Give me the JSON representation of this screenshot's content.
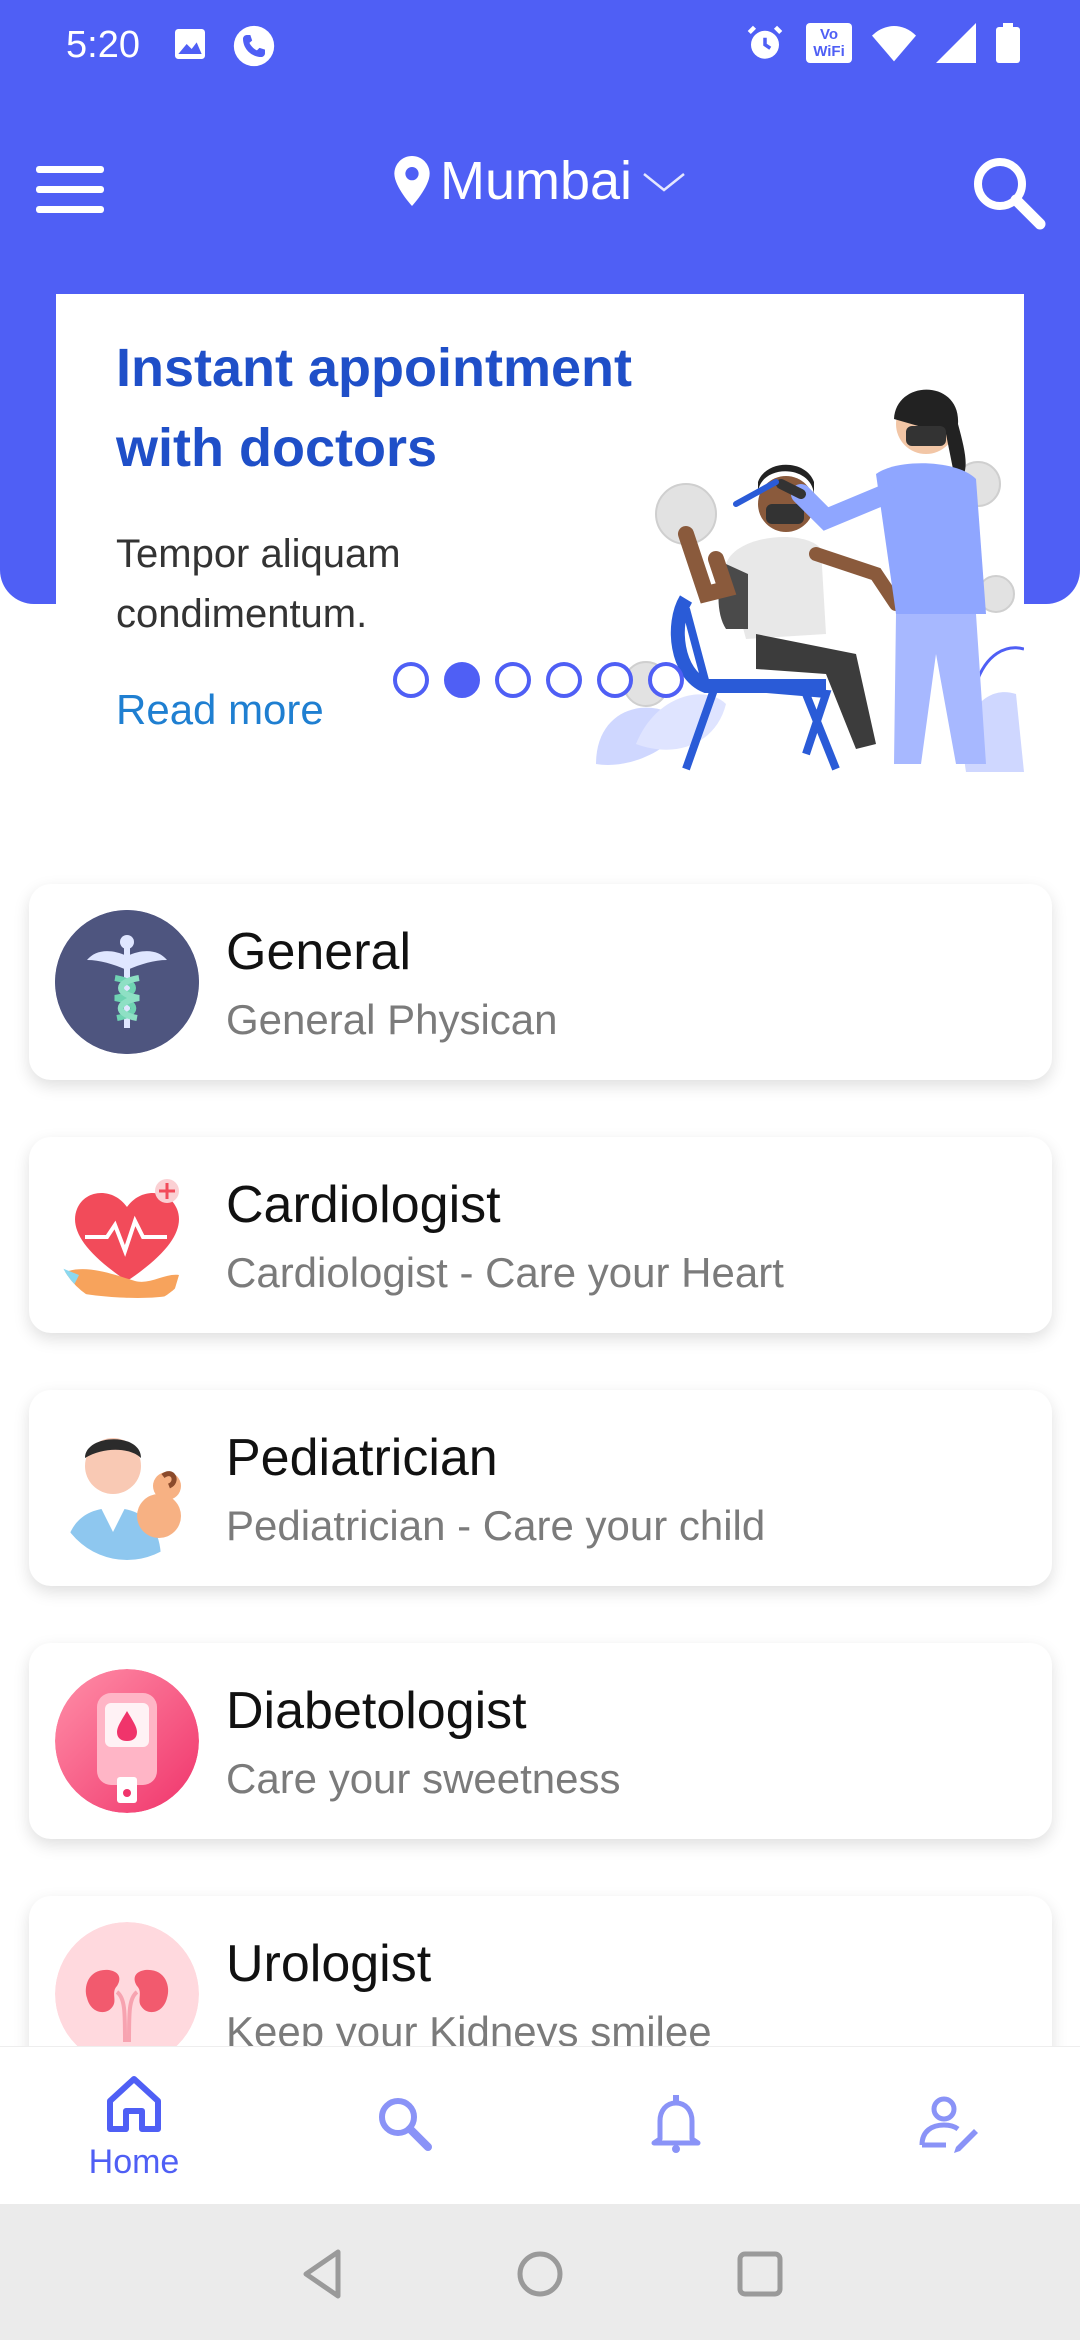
{
  "status_bar": {
    "time": "5:20",
    "left_icons": [
      "image-icon",
      "phone-call-icon"
    ],
    "right_icons": [
      "alarm-icon",
      "vowifi-icon",
      "wifi-icon",
      "signal-icon",
      "battery-icon"
    ],
    "vowifi_top": "Vo",
    "vowifi_bottom": "WiFi"
  },
  "app_bar": {
    "location": "Mumbai",
    "icons": [
      "menu-icon",
      "location-pin-icon",
      "chevron-down-icon",
      "search-icon"
    ]
  },
  "banner": {
    "title": "Instant appointment with doctors",
    "subtitle": "Tempor aliquam condimentum.",
    "link": "Read more",
    "slides_total": 6,
    "active_slide": 2
  },
  "specialties": [
    {
      "title": "General",
      "subtitle": "General Physican",
      "icon": "caduceus-icon"
    },
    {
      "title": "Cardiologist",
      "subtitle": "Cardiologist - Care your Heart",
      "icon": "heart-icon"
    },
    {
      "title": "Pediatrician",
      "subtitle": "Pediatrician - Care your child",
      "icon": "pediatrician-icon"
    },
    {
      "title": "Diabetologist",
      "subtitle": "Care your sweetness",
      "icon": "glucometer-icon"
    },
    {
      "title": "Urologist",
      "subtitle": "Keep your Kidneys smilee",
      "icon": "kidney-icon"
    }
  ],
  "bottom_nav": {
    "items": [
      {
        "label": "Home",
        "icon": "home-icon",
        "active": true
      },
      {
        "label": "",
        "icon": "search-icon",
        "active": false
      },
      {
        "label": "",
        "icon": "bell-icon",
        "active": false
      },
      {
        "label": "",
        "icon": "profile-edit-icon",
        "active": false
      }
    ]
  },
  "colors": {
    "primary": "#4f5ff5",
    "banner_title": "#1f4fc8",
    "link": "#1f7fd1",
    "subtitle": "#7b7b7b"
  }
}
